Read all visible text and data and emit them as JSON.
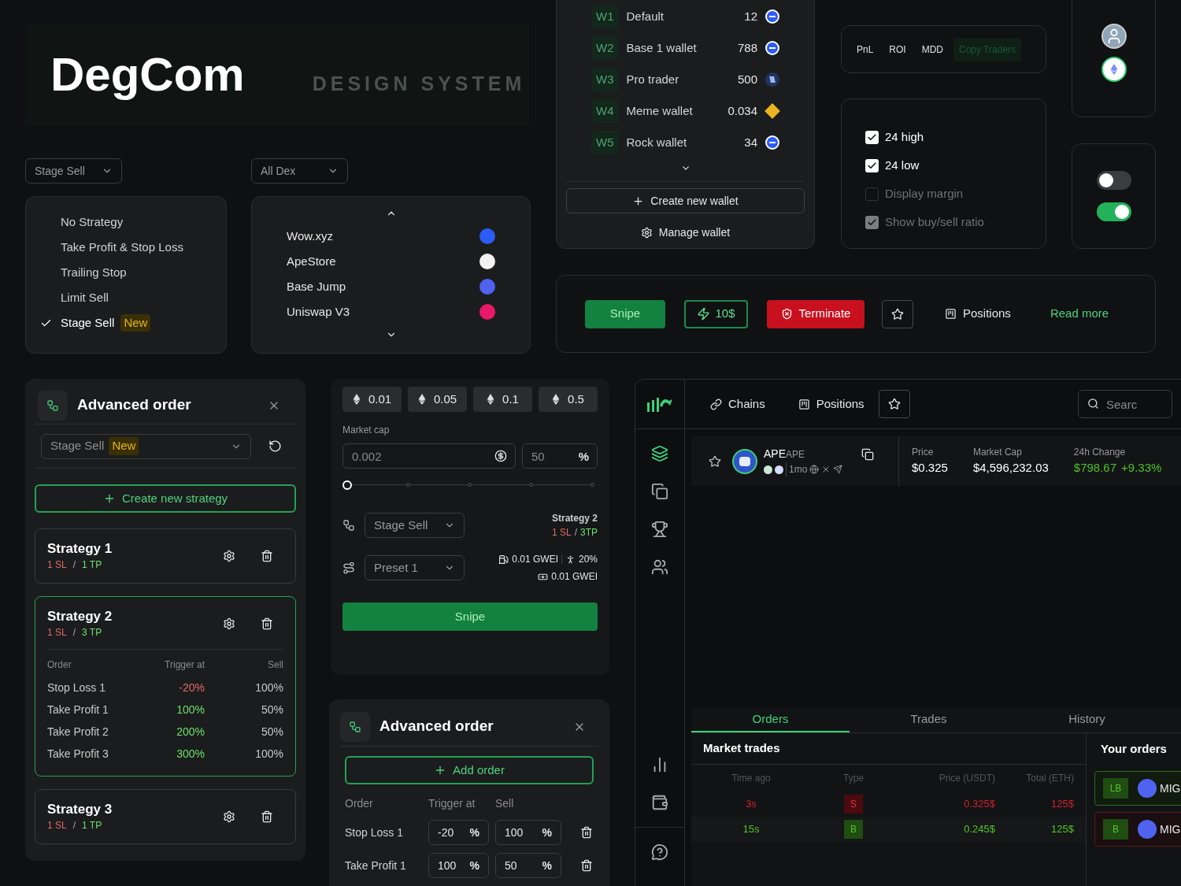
{
  "hero": {
    "title": "DegCom",
    "subtitle": "DESIGN SYSTEM"
  },
  "dropdowns": [
    {
      "value": "Stage Sell"
    },
    {
      "value": "All Dex"
    }
  ],
  "strategy_menu": {
    "items": [
      {
        "label": "No Strategy",
        "selected": false
      },
      {
        "label": "Take Profit & Stop Loss",
        "selected": false
      },
      {
        "label": "Trailing Stop",
        "selected": false
      },
      {
        "label": "Limit Sell",
        "selected": false
      },
      {
        "label": "Stage Sell",
        "selected": true,
        "badge": "New"
      }
    ]
  },
  "dex_menu": {
    "items": [
      {
        "label": "Wow.xyz",
        "color": "#2c5cf6"
      },
      {
        "label": "ApeStore",
        "color": "#f2f2f2"
      },
      {
        "label": "Base Jump",
        "color": "#4f63f0"
      },
      {
        "label": "Uniswap V3",
        "color": "#e8196b"
      }
    ]
  },
  "wallets": {
    "items": [
      {
        "tag": "W1",
        "name": "Default",
        "amount": "12",
        "kind": "base"
      },
      {
        "tag": "W2",
        "name": "Base 1 wallet",
        "amount": "788",
        "kind": "base"
      },
      {
        "tag": "W3",
        "name": "Pro trader",
        "amount": "500",
        "kind": "pro"
      },
      {
        "tag": "W4",
        "name": "Meme wallet",
        "amount": "0.034",
        "kind": "bnb"
      },
      {
        "tag": "W5",
        "name": "Rock wallet",
        "amount": "34",
        "kind": "base"
      }
    ],
    "create_button": "Create new wallet",
    "manage_button": "Manage wallet"
  },
  "metric_tabs": [
    {
      "label": "PnL",
      "selected": false
    },
    {
      "label": "ROI",
      "selected": false
    },
    {
      "label": "MDD",
      "selected": false
    },
    {
      "label": "Copy Traders",
      "selected": true
    }
  ],
  "checkboxes": [
    {
      "label": "24 high",
      "checked": true,
      "disabled": false
    },
    {
      "label": "24 low",
      "checked": true,
      "disabled": false
    },
    {
      "label": "Display margin",
      "checked": false,
      "disabled": true
    },
    {
      "label": "Show buy/sell ratio",
      "checked": true,
      "disabled": true
    }
  ],
  "toggles": [
    {
      "on": false
    },
    {
      "on": true
    }
  ],
  "buttons_row": [
    {
      "kind": "primary",
      "label": "Snipe"
    },
    {
      "kind": "outline",
      "label": "10$"
    },
    {
      "kind": "danger",
      "label": "Terminate"
    },
    {
      "kind": "icon"
    },
    {
      "kind": "ghost",
      "label": "Positions"
    },
    {
      "kind": "link",
      "label": "Read more"
    }
  ],
  "advanced_order": {
    "title": "Advanced order",
    "select": {
      "value": "Stage Sell",
      "badge": "New"
    },
    "create_button": "Create new strategy",
    "strategies": [
      {
        "name": "Strategy 1",
        "sl": "1 SL",
        "sep": "/",
        "tp": "1 TP",
        "expanded": false
      },
      {
        "name": "Strategy 2",
        "sl": "1 SL",
        "sep": "/",
        "tp": "3 TP",
        "expanded": true,
        "columns": [
          "Order",
          "Trigger at",
          "Sell"
        ],
        "rows": [
          {
            "order": "Stop Loss 1",
            "trigger": "-20%",
            "sell": "100%",
            "kind": "loss"
          },
          {
            "order": "Take Profit 1",
            "trigger": "100%",
            "sell": "50%",
            "kind": "profit"
          },
          {
            "order": "Take Profit 2",
            "trigger": "200%",
            "sell": "50%",
            "kind": "profit"
          },
          {
            "order": "Take Profit 3",
            "trigger": "300%",
            "sell": "100%",
            "kind": "profit"
          }
        ]
      },
      {
        "name": "Strategy 3",
        "sl": "1 SL",
        "sep": "/",
        "tp": "1 TP",
        "expanded": false
      }
    ]
  },
  "snipe_panel": {
    "amounts": [
      "0.01",
      "0.05",
      "0.1",
      "0.5"
    ],
    "market_cap_label": "Market cap",
    "market_cap": {
      "placeholder": "0.002"
    },
    "percent": {
      "placeholder": "50",
      "unit": "%"
    },
    "slider": {
      "level": 0
    },
    "strategy_select": "Stage Sell",
    "preset_select": "Preset 1",
    "strategy": {
      "name": "Strategy 2",
      "sl": "1 SL",
      "sep": "/",
      "tp": "3TP"
    },
    "gas": "0.01 GWEI",
    "slippage": "20%",
    "priority": "0.01 GWEI",
    "button": "Snipe"
  },
  "advanced_order_2": {
    "title": "Advanced order",
    "add_button": "Add order",
    "columns": [
      "Order",
      "Trigger at",
      "Sell"
    ],
    "rows": [
      {
        "order": "Stop Loss 1",
        "trigger": "-20",
        "trigger_unit": "%",
        "sell": "100",
        "sell_unit": "%"
      },
      {
        "order": "Take Profit 1",
        "trigger": "100",
        "trigger_unit": "%",
        "sell": "50",
        "sell_unit": "%"
      }
    ]
  },
  "app": {
    "sidebar": {
      "items": [
        {
          "kind": "layers",
          "selected": true
        },
        {
          "kind": "copy",
          "selected": false
        },
        {
          "kind": "trophy",
          "selected": false
        },
        {
          "kind": "users",
          "selected": false
        },
        {
          "kind": "chart",
          "selected": false
        },
        {
          "kind": "wallet",
          "selected": false
        },
        {
          "kind": "help",
          "selected": false
        }
      ]
    },
    "nav": [
      {
        "label": "Chains",
        "kind": "chains"
      },
      {
        "label": "Positions",
        "kind": "positions"
      }
    ],
    "search": {
      "placeholder": "Searc"
    },
    "token": {
      "symbol": "APE",
      "ticker": "APE",
      "age": "1mo"
    },
    "stats": [
      {
        "label": "Price",
        "value": "$0.325"
      },
      {
        "label": "Market Cap",
        "value": "$4,596,232.03"
      },
      {
        "label": "24h Change",
        "value": "$798.67",
        "change": "+9.33%"
      }
    ],
    "tabs": [
      {
        "label": "Orders",
        "selected": true
      },
      {
        "label": "Trades",
        "selected": false
      },
      {
        "label": "History",
        "selected": false
      }
    ],
    "market_trades": {
      "title": "Market trades",
      "columns": [
        "Time ago",
        "Type",
        "Price (USDT)",
        "Total (ETH)"
      ],
      "rows": [
        {
          "time": "3s",
          "type": "S",
          "price": "0.325$",
          "total": "125$",
          "kind": "sell"
        },
        {
          "time": "15s",
          "type": "B",
          "price": "0.245$",
          "total": "125$",
          "kind": "buy"
        }
      ]
    },
    "your_orders": {
      "title": "Your orders",
      "items": [
        {
          "type": "LB",
          "name": "MIG",
          "kind": "buy"
        },
        {
          "type": "B",
          "name": "MIG",
          "kind": "sell"
        }
      ]
    }
  }
}
